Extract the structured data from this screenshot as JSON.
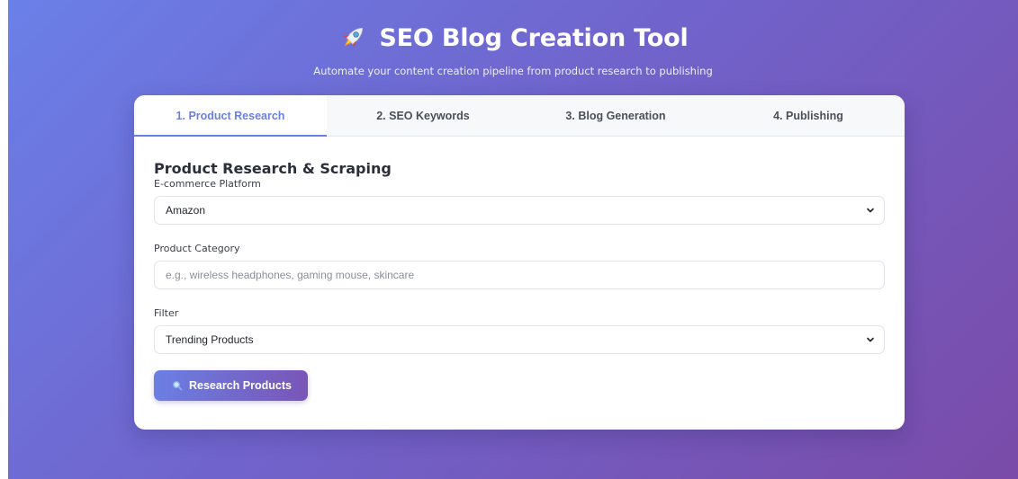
{
  "header": {
    "icon": "rocket-icon",
    "title": "SEO Blog Creation Tool",
    "subtitle": "Automate your content creation pipeline from product research to publishing"
  },
  "tabs": [
    {
      "label": "1. Product Research",
      "active": true
    },
    {
      "label": "2. SEO Keywords",
      "active": false
    },
    {
      "label": "3. Blog Generation",
      "active": false
    },
    {
      "label": "4. Publishing",
      "active": false
    }
  ],
  "section": {
    "title": "Product Research & Scraping"
  },
  "fields": {
    "platform": {
      "label": "E-commerce Platform",
      "value": "Amazon"
    },
    "category": {
      "label": "Product Category",
      "placeholder": "e.g., wireless headphones, gaming mouse, skincare",
      "value": ""
    },
    "filter": {
      "label": "Filter",
      "value": "Trending Products"
    }
  },
  "actions": {
    "research_label": "Research Products",
    "research_icon": "magnifier-icon"
  },
  "colors": {
    "accent": "#6a7fe0",
    "gradient_start": "#6a80e8",
    "gradient_end": "#7a4ba8"
  }
}
